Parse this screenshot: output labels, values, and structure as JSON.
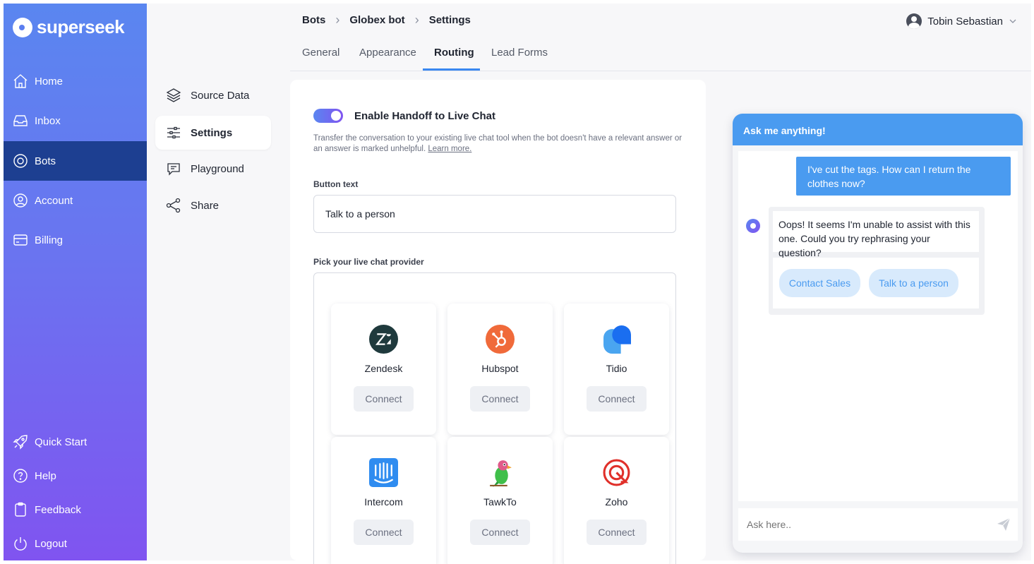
{
  "brand": {
    "name": "superseek"
  },
  "primary_nav": {
    "home": "Home",
    "inbox": "Inbox",
    "bots": "Bots",
    "account": "Account",
    "billing": "Billing",
    "quick_start": "Quick Start",
    "help": "Help",
    "feedback": "Feedback",
    "logout": "Logout",
    "active": "Bots"
  },
  "secondary_nav": {
    "source_data": "Source Data",
    "settings": "Settings",
    "playground": "Playground",
    "share": "Share",
    "active": "Settings"
  },
  "breadcrumb": {
    "level1": "Bots",
    "level2": "Globex bot",
    "level3": "Settings"
  },
  "user": {
    "name": "Tobin Sebastian"
  },
  "tabs": {
    "general": "General",
    "appearance": "Appearance",
    "routing": "Routing",
    "lead_forms": "Lead Forms",
    "active": "Routing"
  },
  "routing": {
    "handoff_toggle_label": "Enable Handoff to Live Chat",
    "handoff_enabled": true,
    "handoff_help": "Transfer the conversation to your existing live chat tool when the bot doesn't have a relevant answer or an answer is marked unhelpful.",
    "learn_more": "Learn more.",
    "button_text_label": "Button text",
    "button_text_value": "Talk to a person",
    "provider_label": "Pick your live chat provider",
    "providers": [
      {
        "name": "Zendesk",
        "action": "Connect"
      },
      {
        "name": "Hubspot",
        "action": "Connect"
      },
      {
        "name": "Tidio",
        "action": "Connect"
      },
      {
        "name": "Intercom",
        "action": "Connect"
      },
      {
        "name": "TawkTo",
        "action": "Connect"
      },
      {
        "name": "Zoho",
        "action": "Connect"
      }
    ]
  },
  "chat_preview": {
    "header": "Ask me anything!",
    "user_message": "I've cut the tags. How can I return the clothes now?",
    "bot_message": "Oops! It seems I'm unable to assist with this one. Could you try rephrasing your question?",
    "action_contact_sales": "Contact Sales",
    "action_talk_person": "Talk to a person",
    "input_placeholder": "Ask here.."
  },
  "colors": {
    "nav_gradient_top": "#5a86f0",
    "nav_gradient_bottom": "#8054f0",
    "nav_active": "#1d3f91",
    "accent": "#3a87f0",
    "chat_header": "#4a9bf0",
    "chip_bg": "#d8eafc"
  }
}
